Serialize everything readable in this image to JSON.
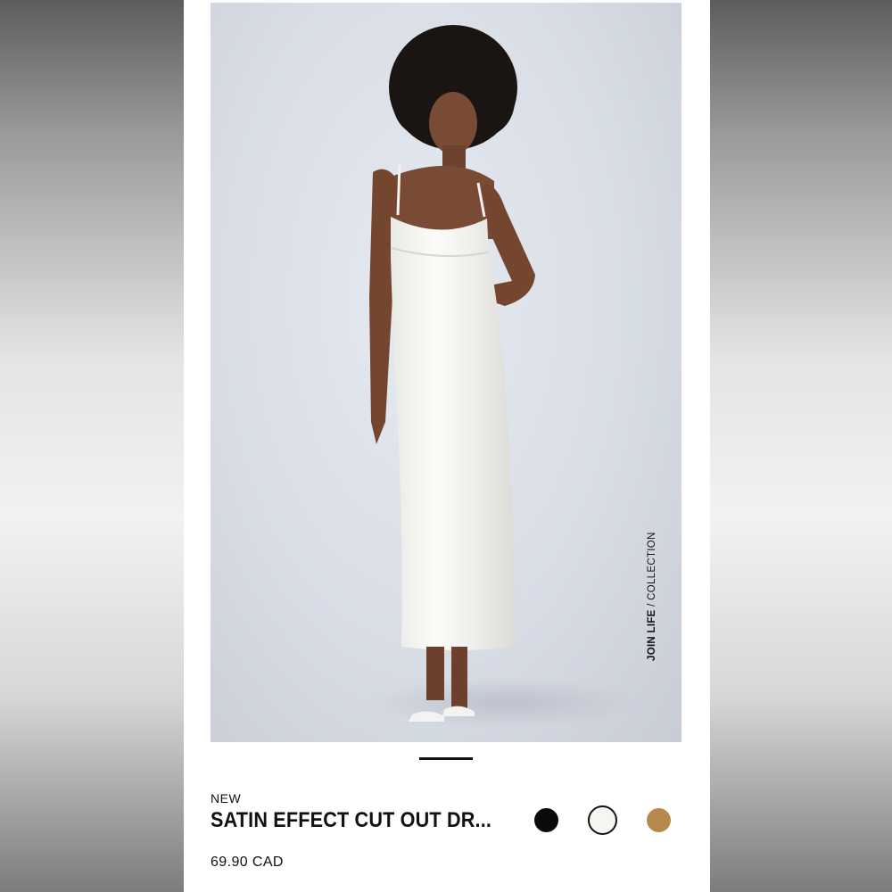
{
  "product": {
    "badge": "NEW",
    "name": "SATIN EFFECT CUT OUT DR...",
    "price": "69.90 CAD",
    "collection_strong": "JOIN LIFE",
    "collection_rest": " / COLLECTION"
  },
  "gallery": {
    "image_description": "model-in-white-satin-slip-dress",
    "current_index": 1
  },
  "colors": [
    {
      "name": "black",
      "hex": "#0a0a0a",
      "selected": false
    },
    {
      "name": "white",
      "hex": "#f6f5f1",
      "selected": true
    },
    {
      "name": "camel",
      "hex": "#b8894d",
      "selected": false
    }
  ]
}
